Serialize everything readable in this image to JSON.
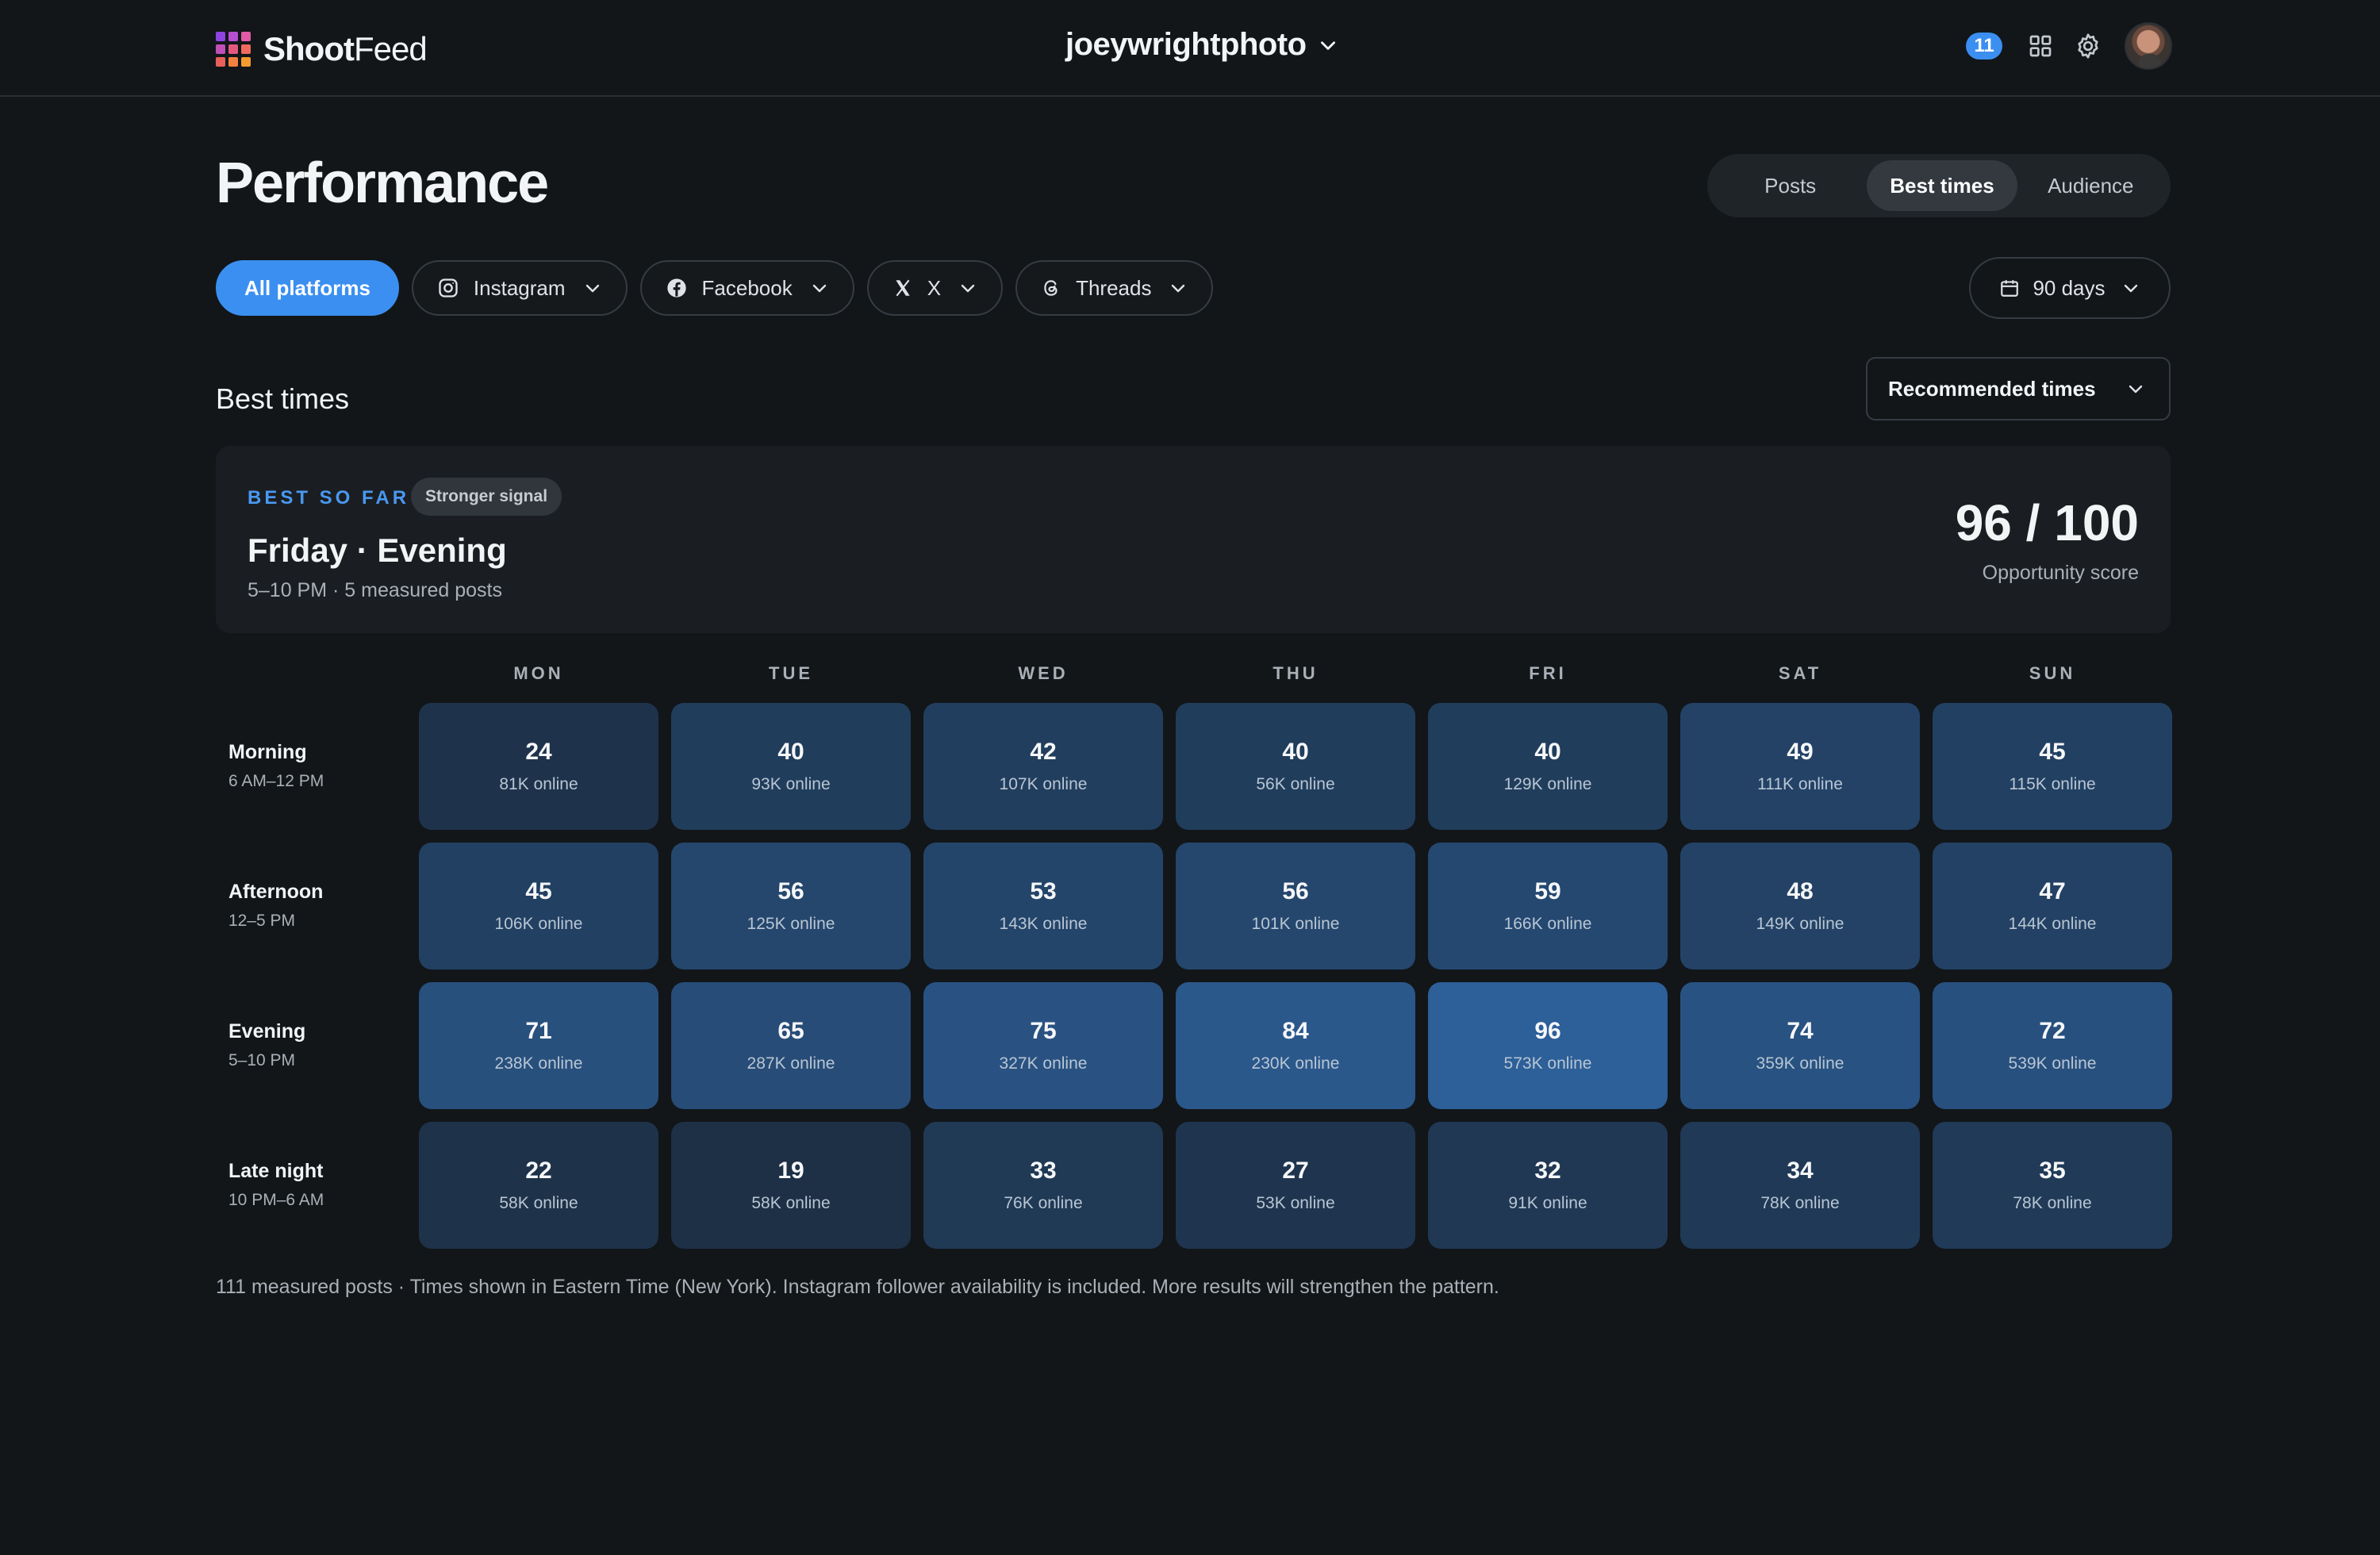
{
  "brand": {
    "name_bold": "Shoot",
    "name_light": "Feed",
    "logo_colors": [
      "#8e44e0",
      "#b84fd0",
      "#e05aa6",
      "#c050b8",
      "#e4587e",
      "#f06a60",
      "#e8605a",
      "#f3803f",
      "#f59a2e"
    ]
  },
  "header": {
    "account": "joeywrightphoto",
    "notifications": "11"
  },
  "page": {
    "title": "Performance"
  },
  "tabs": [
    {
      "label": "Posts",
      "active": false
    },
    {
      "label": "Best times",
      "active": true
    },
    {
      "label": "Audience",
      "active": false
    }
  ],
  "filters": {
    "all": "All platforms",
    "platforms": [
      {
        "label": "Instagram",
        "icon": "instagram-icon"
      },
      {
        "label": "Facebook",
        "icon": "facebook-icon"
      },
      {
        "label": "X",
        "icon": "x-icon"
      },
      {
        "label": "Threads",
        "icon": "threads-icon"
      }
    ],
    "range": "90 days"
  },
  "section": {
    "title": "Best times",
    "view_select": "Recommended times"
  },
  "best": {
    "label": "BEST SO FAR",
    "signal": "Stronger signal",
    "slot": "Friday · Evening",
    "detail": "5–10 PM · 5 measured posts",
    "score": "96 / 100",
    "score_label": "Opportunity score"
  },
  "heatmap": {
    "days": [
      "MON",
      "TUE",
      "WED",
      "THU",
      "FRI",
      "SAT",
      "SUN"
    ],
    "rows": [
      {
        "name": "Morning",
        "range": "6 AM–12 PM",
        "cells": [
          {
            "score": "24",
            "online": "81K online"
          },
          {
            "score": "40",
            "online": "93K online"
          },
          {
            "score": "42",
            "online": "107K online"
          },
          {
            "score": "40",
            "online": "56K online"
          },
          {
            "score": "40",
            "online": "129K online"
          },
          {
            "score": "49",
            "online": "111K online"
          },
          {
            "score": "45",
            "online": "115K online"
          }
        ]
      },
      {
        "name": "Afternoon",
        "range": "12–5 PM",
        "cells": [
          {
            "score": "45",
            "online": "106K online"
          },
          {
            "score": "56",
            "online": "125K online"
          },
          {
            "score": "53",
            "online": "143K online"
          },
          {
            "score": "56",
            "online": "101K online"
          },
          {
            "score": "59",
            "online": "166K online"
          },
          {
            "score": "48",
            "online": "149K online"
          },
          {
            "score": "47",
            "online": "144K online"
          }
        ]
      },
      {
        "name": "Evening",
        "range": "5–10 PM",
        "cells": [
          {
            "score": "71",
            "online": "238K online"
          },
          {
            "score": "65",
            "online": "287K online"
          },
          {
            "score": "75",
            "online": "327K online"
          },
          {
            "score": "84",
            "online": "230K online"
          },
          {
            "score": "96",
            "online": "573K online"
          },
          {
            "score": "74",
            "online": "359K online"
          },
          {
            "score": "72",
            "online": "539K online"
          }
        ]
      },
      {
        "name": "Late night",
        "range": "10 PM–6 AM",
        "cells": [
          {
            "score": "22",
            "online": "58K online"
          },
          {
            "score": "19",
            "online": "58K online"
          },
          {
            "score": "33",
            "online": "76K online"
          },
          {
            "score": "27",
            "online": "53K online"
          },
          {
            "score": "32",
            "online": "91K online"
          },
          {
            "score": "34",
            "online": "78K online"
          },
          {
            "score": "35",
            "online": "78K online"
          }
        ]
      }
    ]
  },
  "footnote": "111 measured posts · Times shown in Eastern Time (New York). Instagram follower availability is included. More results will strengthen the pattern.",
  "colors": {
    "accent": "#3b8ff0",
    "cell_low": "#1d3046",
    "cell_high": "#2d5f98"
  }
}
